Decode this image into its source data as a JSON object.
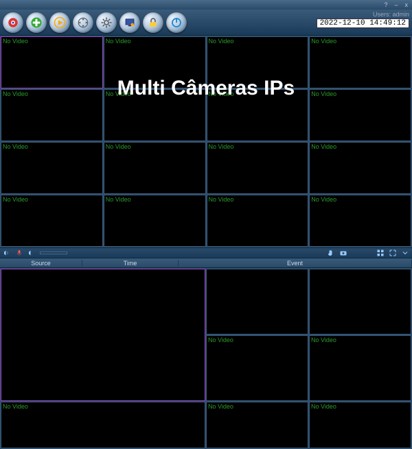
{
  "titlebar": {
    "help": "?",
    "min": "–",
    "close": "x"
  },
  "toolbar": {
    "users_label": "Users:",
    "users_value": "admin",
    "clock": "2022-12-10 14:49:12"
  },
  "overlay": {
    "title": "Multi Câmeras IPs"
  },
  "cell": {
    "no_video": "No Video"
  },
  "log": {
    "cols": {
      "source": "Source",
      "time": "Time",
      "event": "Event"
    }
  },
  "icons": {
    "eye": "eye-icon",
    "add": "add-icon",
    "play": "play-icon",
    "nav": "compass-icon",
    "gear": "gear-icon",
    "monitor": "monitor-icon",
    "lock": "lock-icon",
    "power": "power-icon"
  }
}
